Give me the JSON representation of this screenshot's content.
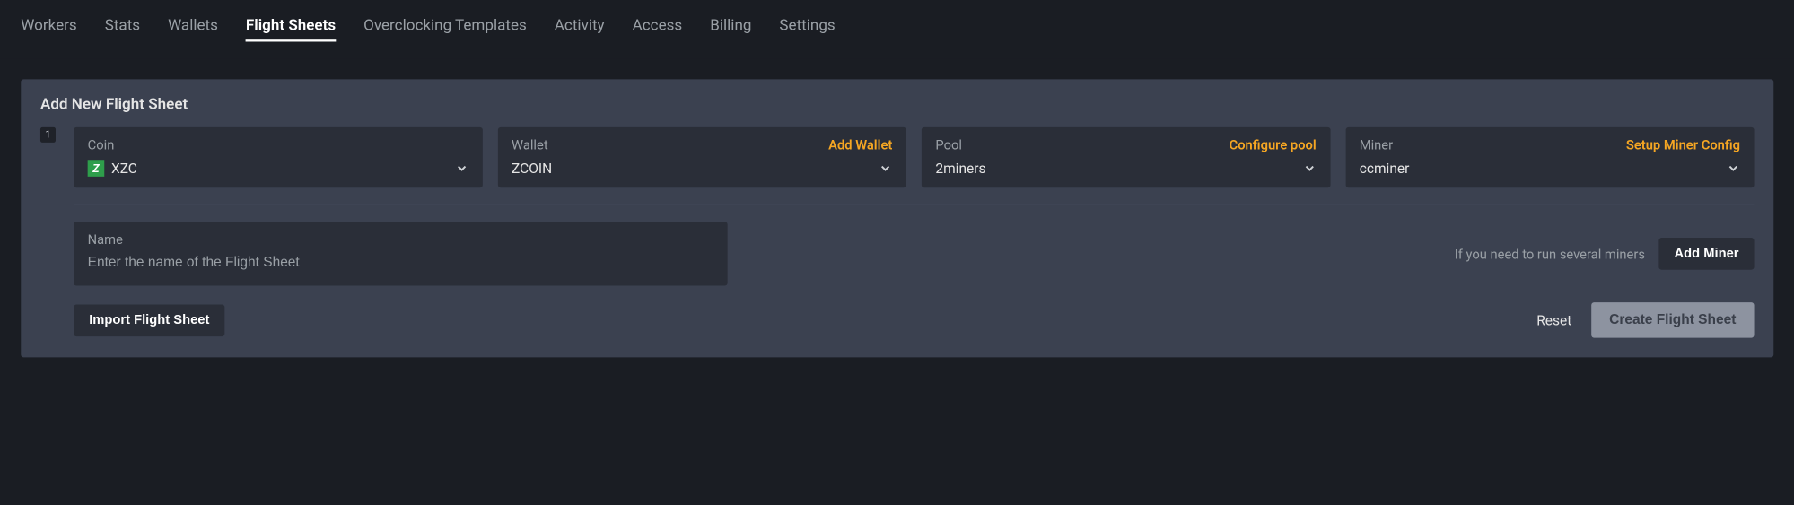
{
  "nav": {
    "items": [
      {
        "label": "Workers",
        "active": false
      },
      {
        "label": "Stats",
        "active": false
      },
      {
        "label": "Wallets",
        "active": false
      },
      {
        "label": "Flight Sheets",
        "active": true
      },
      {
        "label": "Overclocking Templates",
        "active": false
      },
      {
        "label": "Activity",
        "active": false
      },
      {
        "label": "Access",
        "active": false
      },
      {
        "label": "Billing",
        "active": false
      },
      {
        "label": "Settings",
        "active": false
      }
    ]
  },
  "panel": {
    "title": "Add New Flight Sheet",
    "step_badge": "1",
    "selects": {
      "coin": {
        "label": "Coin",
        "action": "",
        "value": "XZC",
        "icon": "Z"
      },
      "wallet": {
        "label": "Wallet",
        "action": "Add Wallet",
        "value": "ZCOIN"
      },
      "pool": {
        "label": "Pool",
        "action": "Configure pool",
        "value": "2miners"
      },
      "miner": {
        "label": "Miner",
        "action": "Setup Miner Config",
        "value": "ccminer"
      }
    },
    "name": {
      "label": "Name",
      "placeholder": "Enter the name of the Flight Sheet"
    },
    "add_miner": {
      "hint": "If you need to run several miners",
      "button": "Add Miner"
    },
    "footer": {
      "import_button": "Import Flight Sheet",
      "reset": "Reset",
      "create_button": "Create Flight Sheet"
    }
  }
}
